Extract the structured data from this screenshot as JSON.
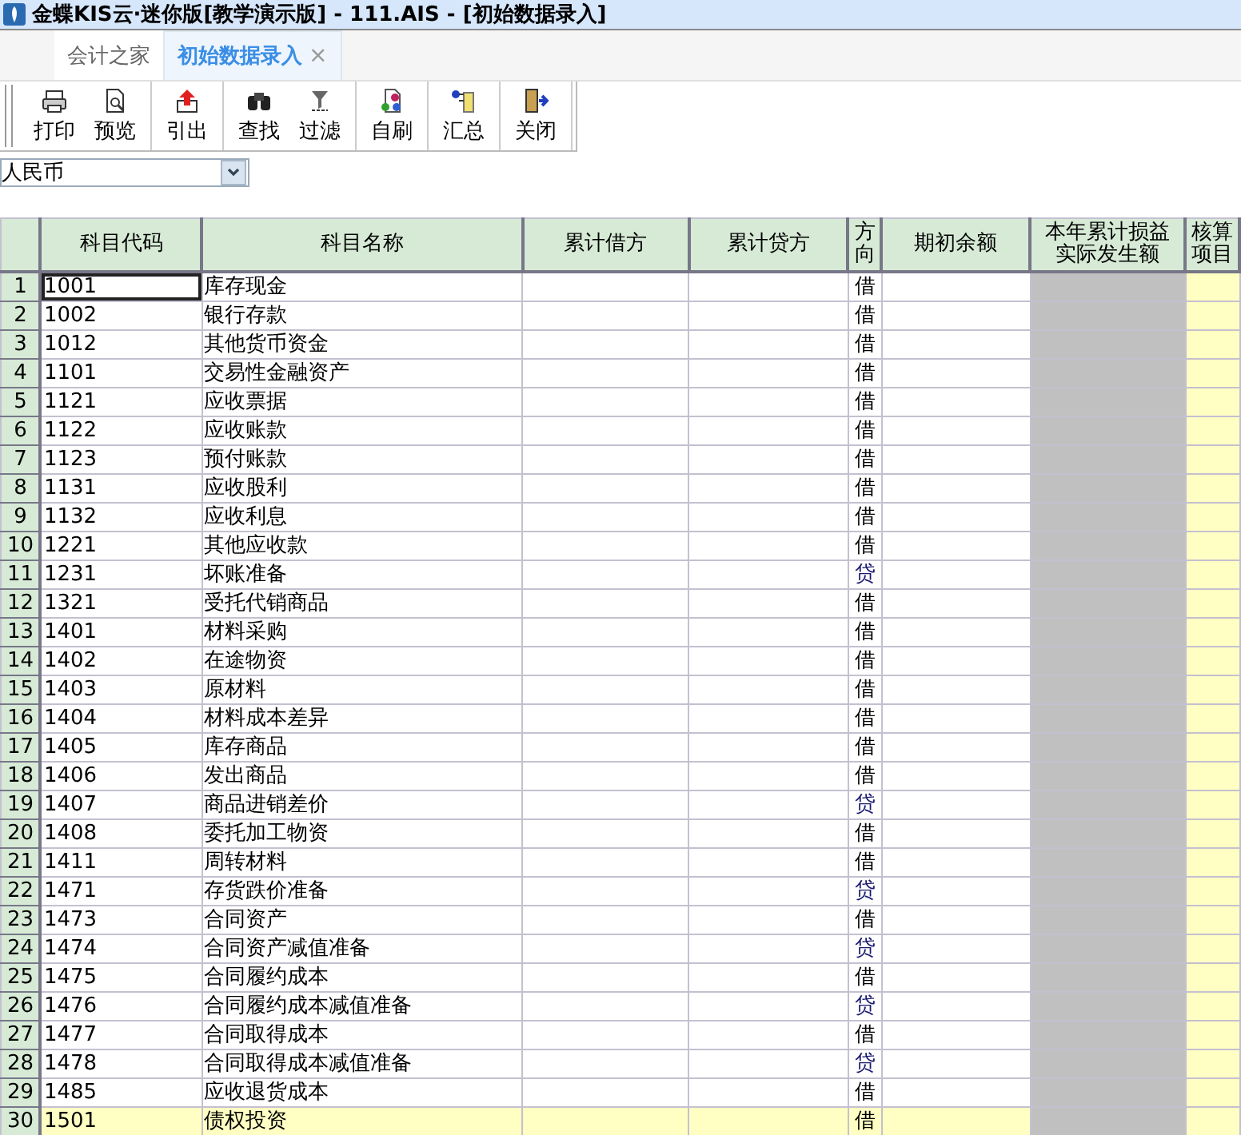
{
  "window": {
    "title": "金蝶KIS云·迷你版[教学演示版] - 111.AIS - [初始数据录入]"
  },
  "tabs": [
    {
      "label": "会计之家",
      "selected": false,
      "closable": false
    },
    {
      "label": "初始数据录入",
      "selected": true,
      "closable": true
    }
  ],
  "close_glyph": "×",
  "toolbar": [
    [
      {
        "label": "打印",
        "kind": "print"
      },
      {
        "label": "预览",
        "kind": "preview"
      }
    ],
    [
      {
        "label": "引出",
        "kind": "export"
      }
    ],
    [
      {
        "label": "查找",
        "kind": "find"
      },
      {
        "label": "过滤",
        "kind": "filter"
      }
    ],
    [
      {
        "label": "自刷",
        "kind": "refresh"
      }
    ],
    [
      {
        "label": "汇总",
        "kind": "summary"
      }
    ],
    [
      {
        "label": "关闭",
        "kind": "close"
      }
    ]
  ],
  "currency": {
    "value": "人民币"
  },
  "table": {
    "columns": [
      "科目代码",
      "科目名称",
      "累计借方",
      "累计贷方",
      "方向",
      "期初余额",
      "本年累计损益实际发生额",
      "核算项目"
    ],
    "rows": [
      {
        "num": "1",
        "code": "1001",
        "name": "库存现金",
        "direction": "借",
        "kind": "debit",
        "selected": false,
        "focused": true
      },
      {
        "num": "2",
        "code": "1002",
        "name": "银行存款",
        "direction": "借",
        "kind": "debit",
        "selected": false,
        "focused": false
      },
      {
        "num": "3",
        "code": "1012",
        "name": "其他货币资金",
        "direction": "借",
        "kind": "debit",
        "selected": false,
        "focused": false
      },
      {
        "num": "4",
        "code": "1101",
        "name": "交易性金融资产",
        "direction": "借",
        "kind": "debit",
        "selected": false,
        "focused": false
      },
      {
        "num": "5",
        "code": "1121",
        "name": "应收票据",
        "direction": "借",
        "kind": "debit",
        "selected": false,
        "focused": false
      },
      {
        "num": "6",
        "code": "1122",
        "name": "应收账款",
        "direction": "借",
        "kind": "debit",
        "selected": false,
        "focused": false
      },
      {
        "num": "7",
        "code": "1123",
        "name": "预付账款",
        "direction": "借",
        "kind": "debit",
        "selected": false,
        "focused": false
      },
      {
        "num": "8",
        "code": "1131",
        "name": "应收股利",
        "direction": "借",
        "kind": "debit",
        "selected": false,
        "focused": false
      },
      {
        "num": "9",
        "code": "1132",
        "name": "应收利息",
        "direction": "借",
        "kind": "debit",
        "selected": false,
        "focused": false
      },
      {
        "num": "10",
        "code": "1221",
        "name": "其他应收款",
        "direction": "借",
        "kind": "debit",
        "selected": false,
        "focused": false
      },
      {
        "num": "11",
        "code": "1231",
        "name": "坏账准备",
        "direction": "贷",
        "kind": "credit",
        "selected": false,
        "focused": false
      },
      {
        "num": "12",
        "code": "1321",
        "name": "受托代销商品",
        "direction": "借",
        "kind": "debit",
        "selected": false,
        "focused": false
      },
      {
        "num": "13",
        "code": "1401",
        "name": "材料采购",
        "direction": "借",
        "kind": "debit",
        "selected": false,
        "focused": false
      },
      {
        "num": "14",
        "code": "1402",
        "name": "在途物资",
        "direction": "借",
        "kind": "debit",
        "selected": false,
        "focused": false
      },
      {
        "num": "15",
        "code": "1403",
        "name": "原材料",
        "direction": "借",
        "kind": "debit",
        "selected": false,
        "focused": false
      },
      {
        "num": "16",
        "code": "1404",
        "name": "材料成本差异",
        "direction": "借",
        "kind": "debit",
        "selected": false,
        "focused": false
      },
      {
        "num": "17",
        "code": "1405",
        "name": "库存商品",
        "direction": "借",
        "kind": "debit",
        "selected": false,
        "focused": false
      },
      {
        "num": "18",
        "code": "1406",
        "name": "发出商品",
        "direction": "借",
        "kind": "debit",
        "selected": false,
        "focused": false
      },
      {
        "num": "19",
        "code": "1407",
        "name": "商品进销差价",
        "direction": "贷",
        "kind": "credit",
        "selected": false,
        "focused": false
      },
      {
        "num": "20",
        "code": "1408",
        "name": "委托加工物资",
        "direction": "借",
        "kind": "debit",
        "selected": false,
        "focused": false
      },
      {
        "num": "21",
        "code": "1411",
        "name": "周转材料",
        "direction": "借",
        "kind": "debit",
        "selected": false,
        "focused": false
      },
      {
        "num": "22",
        "code": "1471",
        "name": "存货跌价准备",
        "direction": "贷",
        "kind": "credit",
        "selected": false,
        "focused": false
      },
      {
        "num": "23",
        "code": "1473",
        "name": "合同资产",
        "direction": "借",
        "kind": "debit",
        "selected": false,
        "focused": false
      },
      {
        "num": "24",
        "code": "1474",
        "name": "合同资产减值准备",
        "direction": "贷",
        "kind": "credit",
        "selected": false,
        "focused": false
      },
      {
        "num": "25",
        "code": "1475",
        "name": "合同履约成本",
        "direction": "借",
        "kind": "debit",
        "selected": false,
        "focused": false
      },
      {
        "num": "26",
        "code": "1476",
        "name": "合同履约成本减值准备",
        "direction": "贷",
        "kind": "credit",
        "selected": false,
        "focused": false
      },
      {
        "num": "27",
        "code": "1477",
        "name": "合同取得成本",
        "direction": "借",
        "kind": "debit",
        "selected": false,
        "focused": false
      },
      {
        "num": "28",
        "code": "1478",
        "name": "合同取得成本减值准备",
        "direction": "贷",
        "kind": "credit",
        "selected": false,
        "focused": false
      },
      {
        "num": "29",
        "code": "1485",
        "name": "应收退货成本",
        "direction": "借",
        "kind": "debit",
        "selected": false,
        "focused": false
      },
      {
        "num": "30",
        "code": "1501",
        "name": "债权投资",
        "direction": "借",
        "kind": "debit",
        "selected": true,
        "focused": false
      }
    ]
  }
}
